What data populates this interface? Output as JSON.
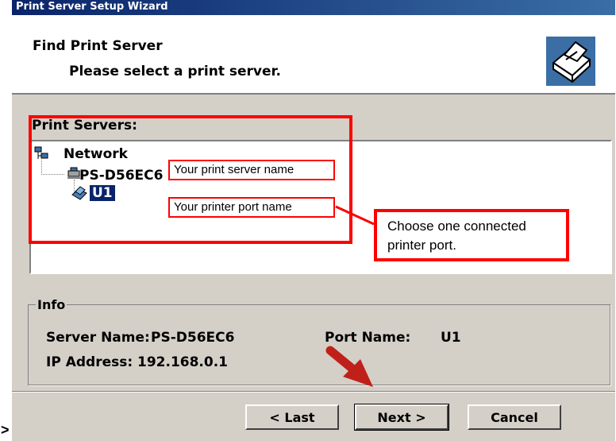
{
  "window": {
    "title": "Print Server Setup Wizard"
  },
  "header": {
    "title": "Find Print Server",
    "subtitle": "Please select a print server.",
    "icon": "printer-icon"
  },
  "servers": {
    "label": "Print Servers:",
    "tree": {
      "root": "Network",
      "server": "PS-D56EC6",
      "port": "U1",
      "selected": "U1"
    }
  },
  "info": {
    "legend": "Info",
    "server_name_label": "Server Name:",
    "server_name_value": "PS-D56EC6",
    "ip_label": "IP Address:",
    "ip_value": "192.168.0.1",
    "port_name_label": "Port Name:",
    "port_name_value": "U1"
  },
  "buttons": {
    "last": "< Last",
    "next": "Next >",
    "cancel": "Cancel"
  },
  "annotations": {
    "server_name": "Your print server name",
    "port_name": "Your printer port name",
    "choose": "Choose one connected printer port.",
    "color": "#ff0000"
  },
  "stray_char": ">"
}
